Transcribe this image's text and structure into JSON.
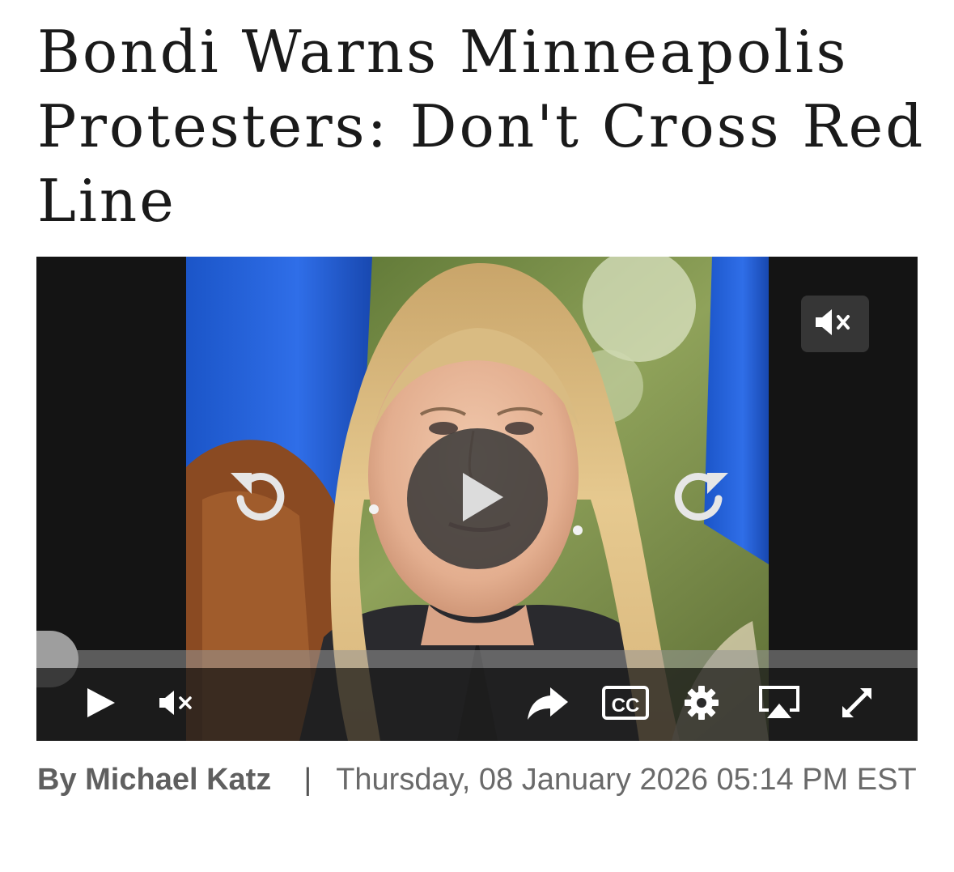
{
  "article": {
    "headline": "Bondi Warns Minneapolis Protesters: Don't Cross Red Line",
    "author": "By Michael Katz",
    "separator": "|",
    "timestamp": "Thursday, 08 January 2026 05:14 PM EST"
  },
  "player": {
    "muted": true,
    "progress": 0,
    "icons": {
      "mute_badge": "speaker-muted-icon",
      "rewind": "rewind-icon",
      "play_big": "play-icon",
      "forward": "forward-icon",
      "play": "play-icon",
      "volume": "speaker-muted-icon",
      "share": "share-arrow-icon",
      "captions": "cc-icon",
      "settings": "gear-icon",
      "airplay": "airplay-icon",
      "fullscreen": "fullscreen-icon"
    },
    "captions_label": "CC"
  },
  "colors": {
    "headline": "#1a1a1a",
    "byline": "#6a6a6a",
    "player_bg": "#141414"
  }
}
